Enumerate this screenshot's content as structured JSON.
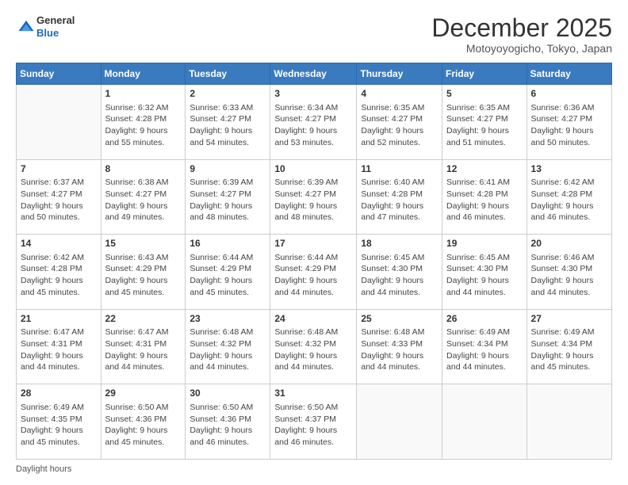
{
  "logo": {
    "general": "General",
    "blue": "Blue"
  },
  "header": {
    "month": "December 2025",
    "location": "Motoyoyogicho, Tokyo, Japan"
  },
  "days_of_week": [
    "Sunday",
    "Monday",
    "Tuesday",
    "Wednesday",
    "Thursday",
    "Friday",
    "Saturday"
  ],
  "footer": {
    "daylight_label": "Daylight hours"
  },
  "weeks": [
    [
      {
        "day": "",
        "info": ""
      },
      {
        "day": "1",
        "info": "Sunrise: 6:32 AM\nSunset: 4:28 PM\nDaylight: 9 hours\nand 55 minutes."
      },
      {
        "day": "2",
        "info": "Sunrise: 6:33 AM\nSunset: 4:27 PM\nDaylight: 9 hours\nand 54 minutes."
      },
      {
        "day": "3",
        "info": "Sunrise: 6:34 AM\nSunset: 4:27 PM\nDaylight: 9 hours\nand 53 minutes."
      },
      {
        "day": "4",
        "info": "Sunrise: 6:35 AM\nSunset: 4:27 PM\nDaylight: 9 hours\nand 52 minutes."
      },
      {
        "day": "5",
        "info": "Sunrise: 6:35 AM\nSunset: 4:27 PM\nDaylight: 9 hours\nand 51 minutes."
      },
      {
        "day": "6",
        "info": "Sunrise: 6:36 AM\nSunset: 4:27 PM\nDaylight: 9 hours\nand 50 minutes."
      }
    ],
    [
      {
        "day": "7",
        "info": "Sunrise: 6:37 AM\nSunset: 4:27 PM\nDaylight: 9 hours\nand 50 minutes."
      },
      {
        "day": "8",
        "info": "Sunrise: 6:38 AM\nSunset: 4:27 PM\nDaylight: 9 hours\nand 49 minutes."
      },
      {
        "day": "9",
        "info": "Sunrise: 6:39 AM\nSunset: 4:27 PM\nDaylight: 9 hours\nand 48 minutes."
      },
      {
        "day": "10",
        "info": "Sunrise: 6:39 AM\nSunset: 4:27 PM\nDaylight: 9 hours\nand 48 minutes."
      },
      {
        "day": "11",
        "info": "Sunrise: 6:40 AM\nSunset: 4:28 PM\nDaylight: 9 hours\nand 47 minutes."
      },
      {
        "day": "12",
        "info": "Sunrise: 6:41 AM\nSunset: 4:28 PM\nDaylight: 9 hours\nand 46 minutes."
      },
      {
        "day": "13",
        "info": "Sunrise: 6:42 AM\nSunset: 4:28 PM\nDaylight: 9 hours\nand 46 minutes."
      }
    ],
    [
      {
        "day": "14",
        "info": "Sunrise: 6:42 AM\nSunset: 4:28 PM\nDaylight: 9 hours\nand 45 minutes."
      },
      {
        "day": "15",
        "info": "Sunrise: 6:43 AM\nSunset: 4:29 PM\nDaylight: 9 hours\nand 45 minutes."
      },
      {
        "day": "16",
        "info": "Sunrise: 6:44 AM\nSunset: 4:29 PM\nDaylight: 9 hours\nand 45 minutes."
      },
      {
        "day": "17",
        "info": "Sunrise: 6:44 AM\nSunset: 4:29 PM\nDaylight: 9 hours\nand 44 minutes."
      },
      {
        "day": "18",
        "info": "Sunrise: 6:45 AM\nSunset: 4:30 PM\nDaylight: 9 hours\nand 44 minutes."
      },
      {
        "day": "19",
        "info": "Sunrise: 6:45 AM\nSunset: 4:30 PM\nDaylight: 9 hours\nand 44 minutes."
      },
      {
        "day": "20",
        "info": "Sunrise: 6:46 AM\nSunset: 4:30 PM\nDaylight: 9 hours\nand 44 minutes."
      }
    ],
    [
      {
        "day": "21",
        "info": "Sunrise: 6:47 AM\nSunset: 4:31 PM\nDaylight: 9 hours\nand 44 minutes."
      },
      {
        "day": "22",
        "info": "Sunrise: 6:47 AM\nSunset: 4:31 PM\nDaylight: 9 hours\nand 44 minutes."
      },
      {
        "day": "23",
        "info": "Sunrise: 6:48 AM\nSunset: 4:32 PM\nDaylight: 9 hours\nand 44 minutes."
      },
      {
        "day": "24",
        "info": "Sunrise: 6:48 AM\nSunset: 4:32 PM\nDaylight: 9 hours\nand 44 minutes."
      },
      {
        "day": "25",
        "info": "Sunrise: 6:48 AM\nSunset: 4:33 PM\nDaylight: 9 hours\nand 44 minutes."
      },
      {
        "day": "26",
        "info": "Sunrise: 6:49 AM\nSunset: 4:34 PM\nDaylight: 9 hours\nand 44 minutes."
      },
      {
        "day": "27",
        "info": "Sunrise: 6:49 AM\nSunset: 4:34 PM\nDaylight: 9 hours\nand 45 minutes."
      }
    ],
    [
      {
        "day": "28",
        "info": "Sunrise: 6:49 AM\nSunset: 4:35 PM\nDaylight: 9 hours\nand 45 minutes."
      },
      {
        "day": "29",
        "info": "Sunrise: 6:50 AM\nSunset: 4:36 PM\nDaylight: 9 hours\nand 45 minutes."
      },
      {
        "day": "30",
        "info": "Sunrise: 6:50 AM\nSunset: 4:36 PM\nDaylight: 9 hours\nand 46 minutes."
      },
      {
        "day": "31",
        "info": "Sunrise: 6:50 AM\nSunset: 4:37 PM\nDaylight: 9 hours\nand 46 minutes."
      },
      {
        "day": "",
        "info": ""
      },
      {
        "day": "",
        "info": ""
      },
      {
        "day": "",
        "info": ""
      }
    ]
  ]
}
